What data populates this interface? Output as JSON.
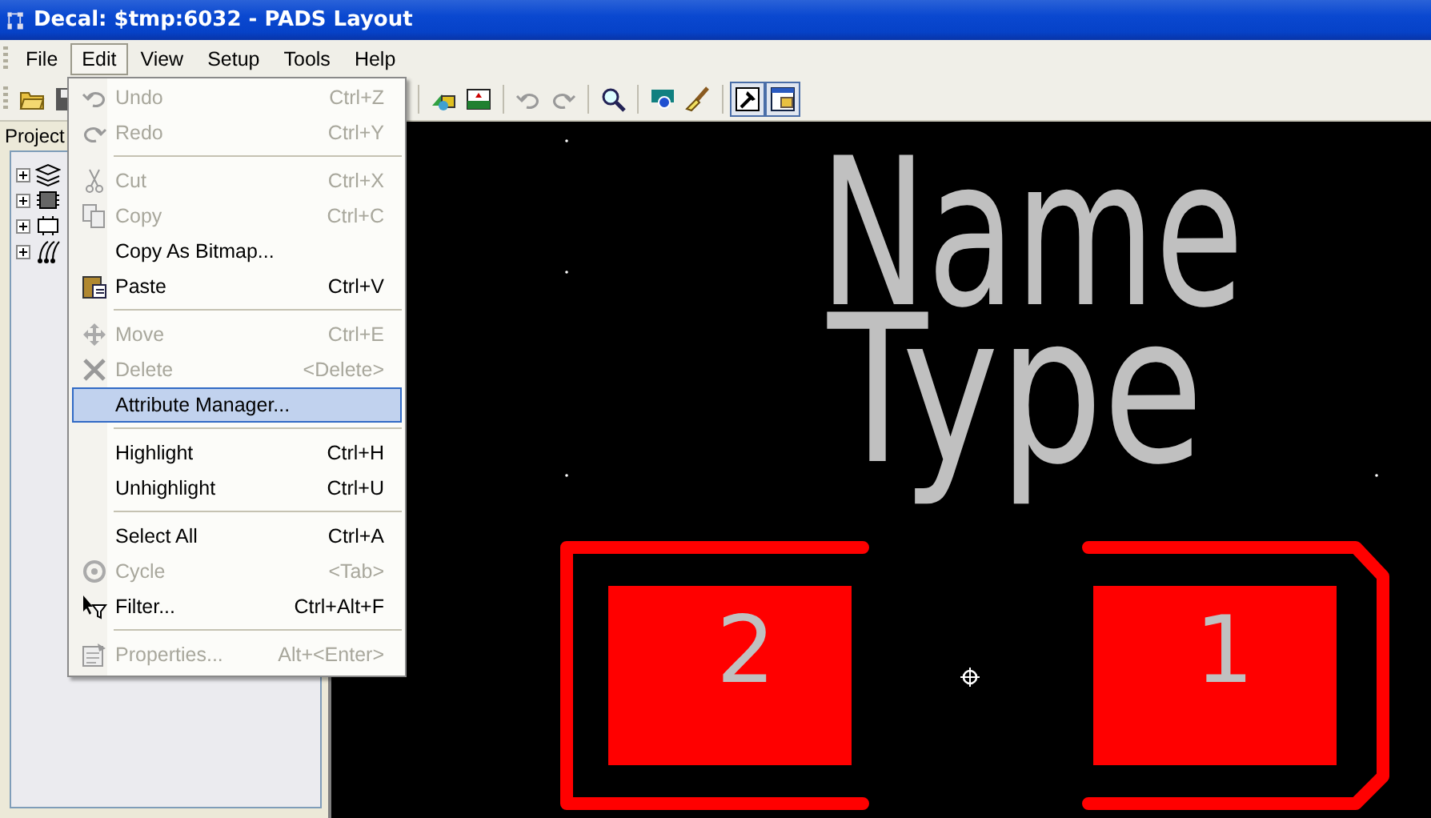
{
  "window": {
    "title": "Decal: $tmp:6032 - PADS Layout"
  },
  "menubar": [
    {
      "label": "File",
      "selected": false
    },
    {
      "label": "Edit",
      "selected": true
    },
    {
      "label": "View",
      "selected": false
    },
    {
      "label": "Setup",
      "selected": false
    },
    {
      "label": "Tools",
      "selected": false
    },
    {
      "label": "Help",
      "selected": false
    }
  ],
  "toolbar": {
    "left": [
      {
        "pressed": false
      },
      {
        "pressed": false
      }
    ],
    "right": [
      {
        "pressed": false
      },
      {
        "pressed": false
      },
      {
        "pressed": false
      },
      {
        "pressed": false
      },
      {
        "pressed": false
      },
      {
        "pressed": false
      },
      {
        "pressed": false
      },
      {
        "pressed": true
      },
      {
        "pressed": true
      }
    ]
  },
  "project_panel": {
    "title": "Project",
    "tree": [
      {
        "expanded": false
      },
      {
        "expanded": false
      },
      {
        "expanded": false
      },
      {
        "expanded": false
      }
    ]
  },
  "edit_menu": [
    {
      "kind": "item",
      "label": "Undo",
      "shortcut": "Ctrl+Z",
      "disabled": true,
      "selected": false
    },
    {
      "kind": "item",
      "label": "Redo",
      "shortcut": "Ctrl+Y",
      "disabled": true,
      "selected": false
    },
    {
      "kind": "separator"
    },
    {
      "kind": "item",
      "label": "Cut",
      "shortcut": "Ctrl+X",
      "disabled": true,
      "selected": false
    },
    {
      "kind": "item",
      "label": "Copy",
      "shortcut": "Ctrl+C",
      "disabled": true,
      "selected": false
    },
    {
      "kind": "item",
      "label": "Copy As Bitmap...",
      "disabled": false,
      "selected": false
    },
    {
      "kind": "item",
      "label": "Paste",
      "shortcut": "Ctrl+V",
      "disabled": false,
      "selected": false
    },
    {
      "kind": "separator"
    },
    {
      "kind": "item",
      "label": "Move",
      "shortcut": "Ctrl+E",
      "disabled": true,
      "selected": false
    },
    {
      "kind": "item",
      "label": "Delete",
      "shortcut": "<Delete>",
      "disabled": true,
      "selected": false
    },
    {
      "kind": "item",
      "label": "Attribute Manager...",
      "disabled": false,
      "selected": true
    },
    {
      "kind": "separator"
    },
    {
      "kind": "item",
      "label": "Highlight",
      "shortcut": "Ctrl+H",
      "disabled": false,
      "selected": false
    },
    {
      "kind": "item",
      "label": "Unhighlight",
      "shortcut": "Ctrl+U",
      "disabled": false,
      "selected": false
    },
    {
      "kind": "separator"
    },
    {
      "kind": "item",
      "label": "Select All",
      "shortcut": "Ctrl+A",
      "disabled": false,
      "selected": false
    },
    {
      "kind": "item",
      "label": "Cycle",
      "shortcut": "<Tab>",
      "disabled": true,
      "selected": false
    },
    {
      "kind": "item",
      "label": "Filter...",
      "shortcut": "Ctrl+Alt+F",
      "disabled": false,
      "selected": false
    },
    {
      "kind": "separator"
    },
    {
      "kind": "item",
      "label": "Properties...",
      "shortcut": "Alt+<Enter>",
      "disabled": true,
      "selected": false
    }
  ],
  "canvas": {
    "labels": [
      "Name",
      "Type"
    ],
    "pads": [
      {
        "number": "2"
      },
      {
        "number": "1"
      }
    ]
  }
}
